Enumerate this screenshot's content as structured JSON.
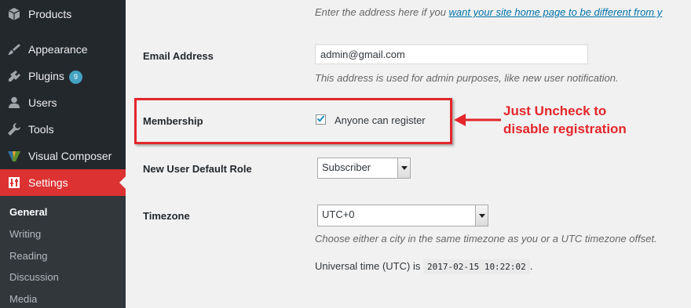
{
  "sidebar": {
    "menu": [
      {
        "label": "Products",
        "icon": "products-icon"
      },
      {
        "label": "Appearance",
        "icon": "paint-brush-icon"
      },
      {
        "label": "Plugins",
        "icon": "plugins-icon",
        "badge": "9"
      },
      {
        "label": "Users",
        "icon": "users-icon"
      },
      {
        "label": "Tools",
        "icon": "wrench-icon"
      },
      {
        "label": "Visual Composer",
        "icon": "visual-composer-icon"
      },
      {
        "label": "Settings",
        "icon": "settings-icon"
      }
    ],
    "submenu": [
      "General",
      "Writing",
      "Reading",
      "Discussion",
      "Media"
    ]
  },
  "main": {
    "site_address_desc_prefix": "Enter the address here if you ",
    "site_address_desc_link": "want your site home page to be different from y",
    "email": {
      "label": "Email Address",
      "value": "admin@gmail.com",
      "desc": "This address is used for admin purposes, like new user notification."
    },
    "membership": {
      "label": "Membership",
      "checkbox_label": "Anyone can register",
      "checked": true
    },
    "default_role": {
      "label": "New User Default Role",
      "value": "Subscriber"
    },
    "timezone": {
      "label": "Timezone",
      "value": "UTC+0",
      "desc": "Choose either a city in the same timezone as you or a UTC timezone offset.",
      "utc_prefix": "Universal time (UTC) is ",
      "utc_time": "2017-02-15 10:22:02",
      "utc_suffix": "."
    }
  },
  "annotation": {
    "line1": "Just Uncheck to",
    "line2": "disable registration",
    "color": "#e3262b"
  },
  "colors": {
    "sidebar_bg": "#23282d",
    "active_menu": "#dc3232",
    "link": "#0073aa"
  }
}
